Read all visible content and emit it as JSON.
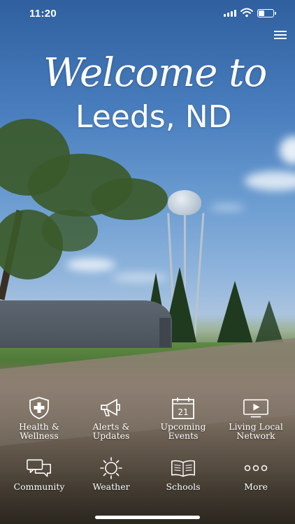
{
  "status_bar": {
    "time": "11:20"
  },
  "hero": {
    "welcome_text": "Welcome to",
    "town_text": "Leeds, ND"
  },
  "grid": [
    {
      "label": "Health & Wellness",
      "line1": "Health &",
      "line2": "Wellness",
      "icon": "health-shield-icon"
    },
    {
      "label": "Alerts & Updates",
      "line1": "Alerts &",
      "line2": "Updates",
      "icon": "megaphone-icon"
    },
    {
      "label": "Upcoming Events",
      "line1": "Upcoming",
      "line2": "Events",
      "icon": "calendar-icon",
      "calendar_day": "21"
    },
    {
      "label": "Living Local Network",
      "line1": "Living Local",
      "line2": "Network",
      "icon": "tv-play-icon"
    },
    {
      "label": "Community",
      "line1": "Community",
      "icon": "chat-bubbles-icon"
    },
    {
      "label": "Weather",
      "line1": "Weather",
      "icon": "sun-icon"
    },
    {
      "label": "Schools",
      "line1": "Schools",
      "icon": "book-icon"
    },
    {
      "label": "More",
      "line1": "More",
      "icon": "more-dots-icon"
    }
  ],
  "colors": {
    "icon_text": "#ffffff"
  }
}
